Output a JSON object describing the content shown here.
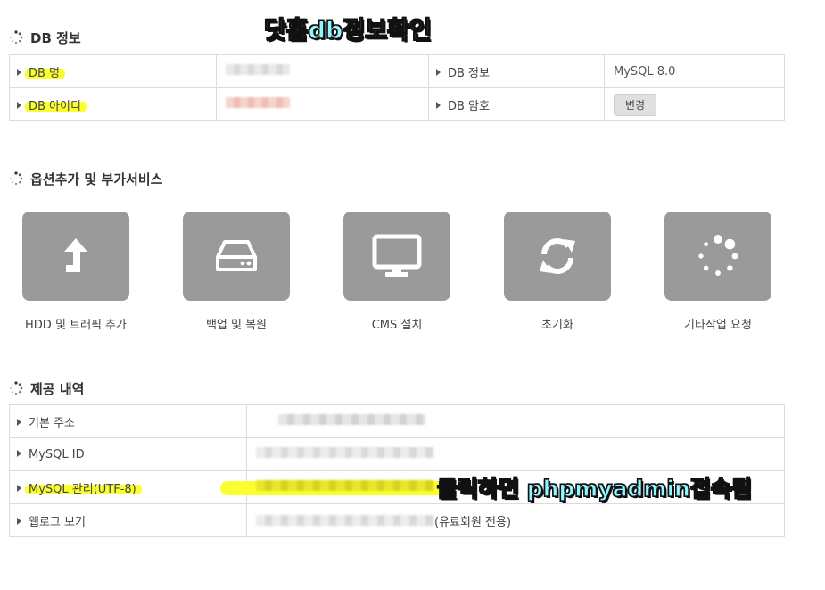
{
  "annotations": {
    "top": "닷홈db정보확인",
    "bottom": "클릭하면 phpmyadmin접속됨"
  },
  "db_section": {
    "title": "DB 정보",
    "name_label": "DB 명",
    "id_label": "DB 아이디",
    "info_label": "DB 정보",
    "info_value": "MySQL 8.0",
    "password_label": "DB 암호",
    "change_button": "변경"
  },
  "services_section": {
    "title": "옵션추가 및 부가서비스",
    "items": [
      {
        "label": "HDD 및 트래픽 추가",
        "icon": "arrow-up-icon"
      },
      {
        "label": "백업 및 복원",
        "icon": "hard-drive-icon"
      },
      {
        "label": "CMS 설치",
        "icon": "monitor-icon"
      },
      {
        "label": "초기화",
        "icon": "refresh-icon"
      },
      {
        "label": "기타작업 요청",
        "icon": "spinner-icon"
      }
    ]
  },
  "provided_section": {
    "title": "제공 내역",
    "rows": [
      {
        "label": "기본 주소",
        "suffix": ""
      },
      {
        "label": "MySQL ID",
        "suffix": ""
      },
      {
        "label": "MySQL 관리(UTF-8)",
        "suffix": ""
      },
      {
        "label": "웹로그 보기",
        "suffix": "(유료회원 전용)"
      }
    ]
  },
  "colors": {
    "highlight": "#fbff2f",
    "annotation": "#8ff7ff",
    "tile": "#9a9a9a",
    "border": "#dcdcdc"
  }
}
